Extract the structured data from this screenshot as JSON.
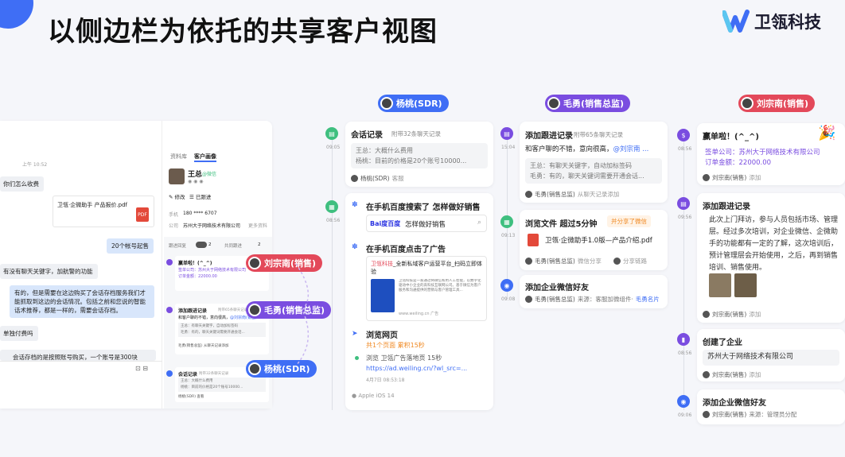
{
  "header": {
    "title": "以侧边栏为依托的共享客户视图",
    "logo_text": "卫瓴科技"
  },
  "colors": {
    "accent": "#3f6ef5",
    "sdr": "#3f6ef5",
    "manager": "#7a4de0",
    "sales": "#e3495a",
    "green": "#3fbf7f"
  },
  "chat": {
    "time": "上午 10:52",
    "msg1": "你们怎么收费",
    "file_name": "卫瓴·企微助手 产品报价.pdf",
    "msg_accounts": "20个帐号起售",
    "msg_keywords": "有没有聊天关键字，加航警的功能",
    "msg_reply": "有的，但是需要在这边购买了会话存档服务我们才能抓取到这边的会话情况。包括之前和您说的智能话术推荐，都是一样的，需要会话存档。",
    "msg_pay": "单独付费吗",
    "msg_last": "会话存档的是按照账号购买，一个账号是300块",
    "tab_profile": "资料库",
    "tab_customer": "客户画像",
    "name": "王总",
    "tag": "@微信",
    "btn_edit": "✎ 修改",
    "btn_talk": "☰ 已跟进",
    "phone_label": "手机",
    "phone": "180 **** 6707",
    "company_label": "公司",
    "company": "苏州大于网络技术有限公司",
    "more": "更多资料",
    "mini_label1": "跟进回复",
    "mini_label2": "共同跟进",
    "mini_count1": "2",
    "mini_count2": "2",
    "mini_deal": "赢单啦！(^_^)",
    "mini_deal_co": "签单公司：苏州大于网络技术有限公司",
    "mini_deal_amt": "订单金额：22000.00",
    "mini_follow": "添加跟进记录",
    "mini_follow_sub": "附带65条聊天记录",
    "mini_follow_txt": "和客户聊的不错，意向很高，",
    "mini_follow_at": "@刘宗南(销售)",
    "mini_follow_g1": "王总：有聊天关键字，自动加标签码",
    "mini_follow_g2": "毛勇：有的，聊天关键词需要开通会话...",
    "mini_follow_who": "毛勇(销售总监) 从聊天记录添加",
    "mini_conv": "会话记录",
    "mini_conv_sub": "附带32条聊天记录",
    "mini_conv_g1": "王总：大概什么费用",
    "mini_conv_g2": "杨桃：目前的价格是20个账号10000...",
    "mini_conv_who": "杨桃(SDR) 查看"
  },
  "overlay_pills": [
    {
      "label": "刘宗南(销售)"
    },
    {
      "label": "毛勇(销售总监)"
    },
    {
      "label": "杨桃(SDR)"
    }
  ],
  "col_sdr": {
    "role": "杨桃(SDR)",
    "t1": "09:05",
    "conv_title": "会话记录",
    "conv_sub": "附带32条聊天记录",
    "conv_line1": "王总：大概什么费用",
    "conv_line2": "杨桃：目前的价格是20个账号10000...",
    "conv_who": "杨桃(SDR)",
    "conv_act": "客服",
    "t2": "08:56",
    "search_title": "在手机百度搜索了 怎样做好销售",
    "search_brand": "Bai度百度",
    "search_query": "怎样做好销售",
    "ad_title": "在手机百度点击了广告",
    "ad_brand": "卫瓴科技",
    "ad_text": "_全新私域客户运营平台_扫码立即体验",
    "ad_desc": "卫瓴科技是一家通过将微信和用人工智能，以数字化驱动中小企业的高科技互联网公司。基于微信为客户服务和沟通提供的营销与客户管理工具...",
    "ad_site": "www.weiling.cn 广告",
    "browse_title": "浏览网页",
    "browse_meta": "共1个页面 累积15秒",
    "browse_page": "浏览 卫瓴广告落地页 15秒",
    "browse_url": "https://ad.weiling.cn/?wl_src=...",
    "browse_date": "4月7日 08:53:18",
    "device": "Apple iOS 14"
  },
  "col_manager": {
    "role": "毛勇(销售总监)",
    "t1": "15:04",
    "follow_title": "添加跟进记录",
    "follow_sub": "附带65条聊天记录",
    "follow_text": "和客户聊的不错，意向很高，",
    "follow_at": "@刘宗南 ...",
    "follow_g1": "王总：有聊天关键字，自动加标签码",
    "follow_g2": "毛勇：有的，聊天关键词需要开通会话...",
    "follow_who": "毛勇(销售总监)",
    "follow_act": "从聊天记录添加",
    "t2": "09:13",
    "file_title": "浏览文件",
    "file_time": "超过5分钟",
    "file_badge": "并分享了微信",
    "file_name": "卫瓴·企微助手1.0版—产品介绍.pdf",
    "file_who": "毛勇(销售总监)",
    "file_act": "微信分享",
    "file_link": "分享链路",
    "t3": "09:08",
    "wx_title": "添加企业微信好友",
    "wx_who": "毛勇(销售总监)",
    "wx_src": "来源：客服加微组件·",
    "wx_card": "毛勇名片"
  },
  "col_sales": {
    "role": "刘宗南(销售)",
    "t1": "08:56",
    "deal_title": "赢单啦！(^_^)",
    "deal_co_label": "签单公司：",
    "deal_co": "苏州大于网络技术有限公司",
    "deal_amt_label": "订单金额：",
    "deal_amt": "22000.00",
    "deal_who": "刘宗南(销售)",
    "deal_act": "添加",
    "t2": "09:56",
    "follow_title": "添加跟进记录",
    "follow_text": "此次上门拜访，参与人员包括市场、管理层。经过多次培训，对企业微信、企微助手的功能都有一定的了解，这次培训后，预计管理层会开始使用，之后，再到销售培训、销售使用。",
    "follow_who": "刘宗南(销售)",
    "follow_act": "添加",
    "t3": "08:56",
    "ent_title": "创建了企业",
    "ent_name": "苏州大于网络技术有限公司",
    "ent_who": "刘宗南(销售)",
    "ent_act": "添加",
    "t4": "09:06",
    "wx_title": "添加企业微信好友",
    "wx_who": "刘宗南(销售)",
    "wx_src": "来源：管理员分配"
  }
}
